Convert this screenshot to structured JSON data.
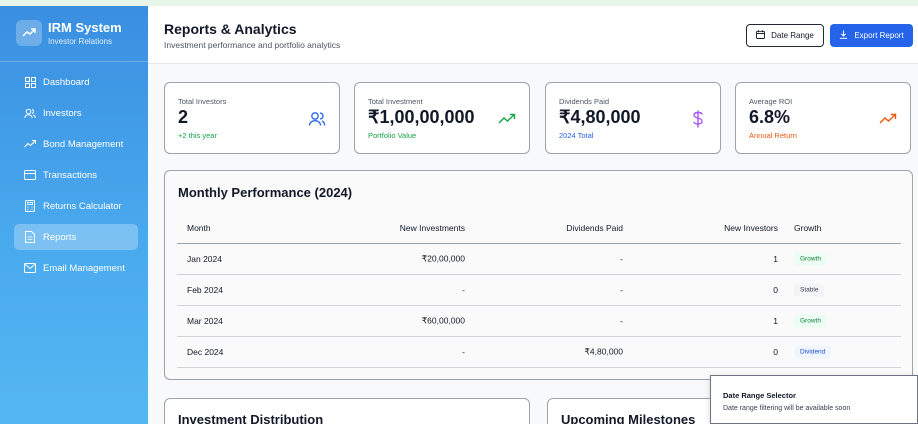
{
  "brand": {
    "title": "IRM System",
    "subtitle": "Investor Relations"
  },
  "sidebar": {
    "items": [
      {
        "label": "Dashboard",
        "icon": "grid-icon"
      },
      {
        "label": "Investors",
        "icon": "users-icon"
      },
      {
        "label": "Bond Management",
        "icon": "trending-up-icon"
      },
      {
        "label": "Transactions",
        "icon": "card-icon"
      },
      {
        "label": "Returns Calculator",
        "icon": "calculator-icon"
      },
      {
        "label": "Reports",
        "icon": "file-icon",
        "active": true
      },
      {
        "label": "Email Management",
        "icon": "mail-icon"
      }
    ]
  },
  "header": {
    "title": "Reports & Analytics",
    "subtitle": "Investment performance and portfolio analytics",
    "date_range_label": "Date Range",
    "export_label": "Export Report"
  },
  "stats": [
    {
      "label": "Total Investors",
      "value": "2",
      "note": "+2 this year",
      "note_color": "#16a34a",
      "icon": "users-icon",
      "icon_color": "#2563eb"
    },
    {
      "label": "Total Investment",
      "value": "₹1,00,00,000",
      "note": "Portfolio Value",
      "note_color": "#16a34a",
      "icon": "trending-up-icon",
      "icon_color": "#16a34a"
    },
    {
      "label": "Dividends Paid",
      "value": "₹4,80,000",
      "note": "2024 Total",
      "note_color": "#2563eb",
      "icon": "dollar-icon",
      "icon_color": "#a855f7"
    },
    {
      "label": "Average ROI",
      "value": "6.8%",
      "note": "Annual Return",
      "note_color": "#ea580c",
      "icon": "trending-up-icon",
      "icon_color": "#ea580c"
    }
  ],
  "performance": {
    "title": "Monthly Performance (2024)",
    "columns": [
      "Month",
      "New Investments",
      "Dividends Paid",
      "New Investors",
      "Growth"
    ],
    "rows": [
      {
        "month": "Jan 2024",
        "investments": "₹20,00,000",
        "dividends": "-",
        "new_investors": "1",
        "growth": "Growth"
      },
      {
        "month": "Feb 2024",
        "investments": "-",
        "dividends": "-",
        "new_investors": "0",
        "growth": "Stable"
      },
      {
        "month": "Mar 2024",
        "investments": "₹60,00,000",
        "dividends": "-",
        "new_investors": "1",
        "growth": "Growth"
      },
      {
        "month": "Dec 2024",
        "investments": "-",
        "dividends": "₹4,80,000",
        "new_investors": "0",
        "growth": "Dividend"
      }
    ]
  },
  "panels": {
    "distribution_title": "Investment Distribution",
    "milestones_title": "Upcoming Milestones"
  },
  "toast": {
    "title": "Date Range Selector",
    "message": "Date range filtering will be available soon"
  },
  "colors": {
    "sidebar_top": "#3a8fe0",
    "sidebar_bottom": "#55b7f2",
    "primary": "#2563eb"
  }
}
